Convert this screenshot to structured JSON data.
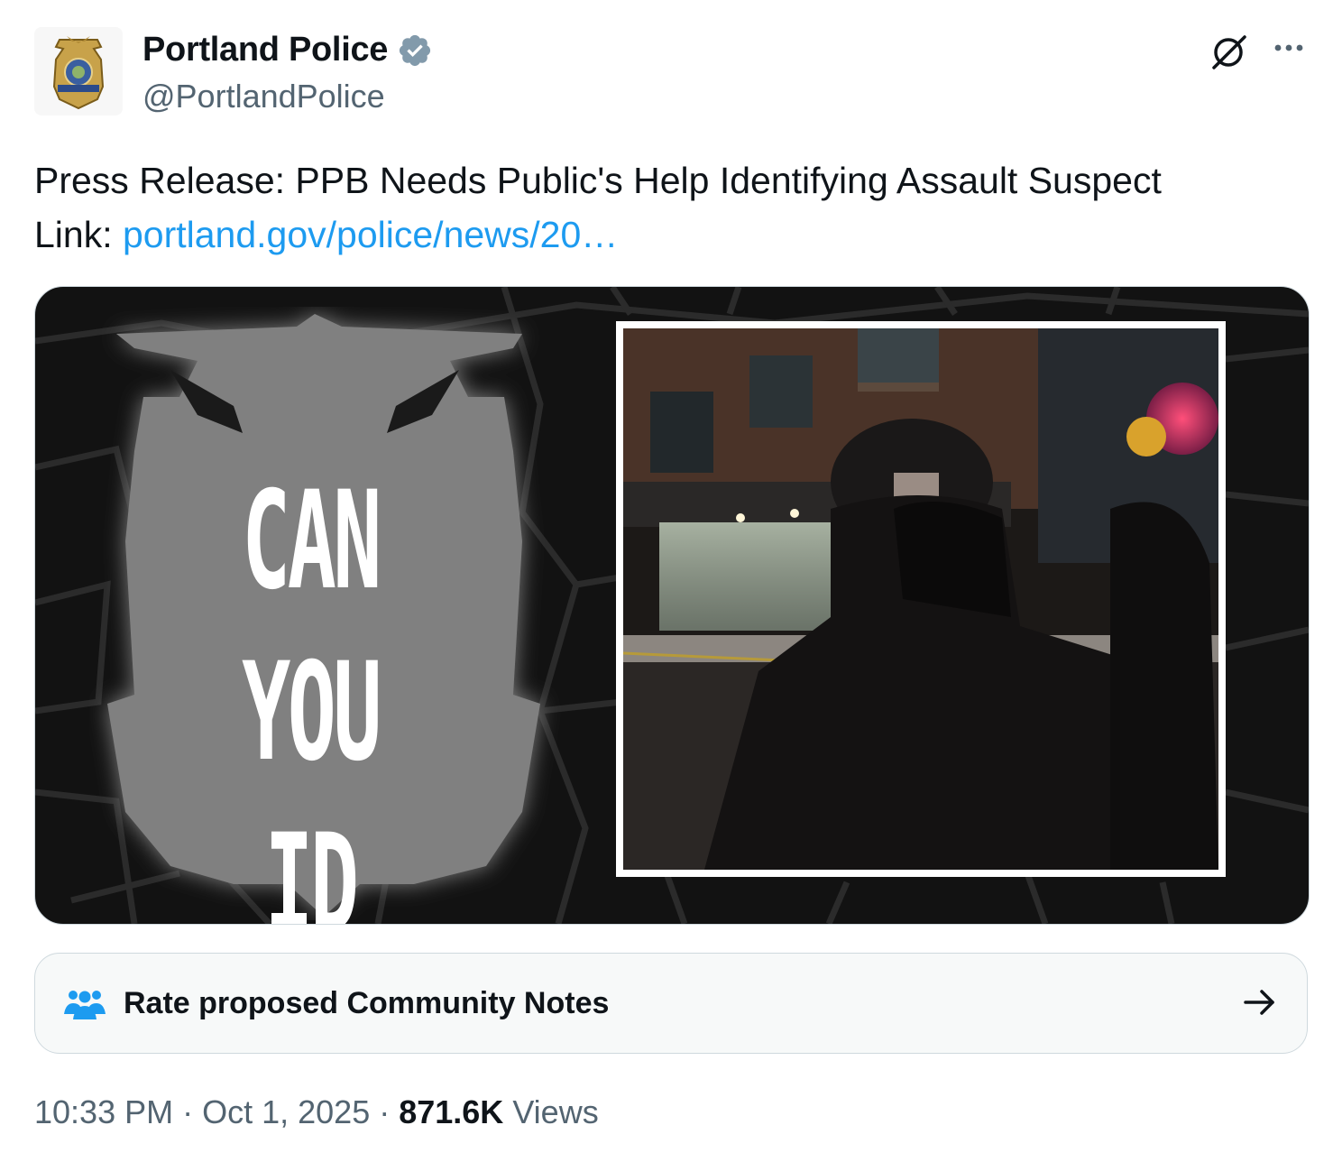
{
  "tweet": {
    "author": {
      "display_name": "Portland Police",
      "handle": "@PortlandPolice",
      "verified": true,
      "avatar": "police-badge"
    },
    "text_line1": "Press Release: PPB Needs Public's Help Identifying Assault Suspect",
    "link_prefix": "Link: ",
    "link_text": "portland.gov/police/news/20…",
    "media": {
      "badge_line1": "CAN YOU",
      "badge_line2": "ID ME?",
      "photo": "masked-suspect-at-night"
    },
    "community_notes": {
      "label": "Rate proposed Community Notes",
      "icon": "people-icon",
      "arrow": "arrow-right-icon"
    },
    "timestamp": {
      "time": "10:33 PM",
      "separator": " · ",
      "date": "Oct 1, 2025",
      "views_count": "871.6K",
      "views_label": " Views"
    }
  },
  "colors": {
    "link": "#1d9bf0",
    "verified": "#829aab",
    "secondary_text": "#536471",
    "notes_icon": "#1d9bf0"
  },
  "icons": {
    "grok": "grok-icon",
    "more": "more-icon"
  }
}
